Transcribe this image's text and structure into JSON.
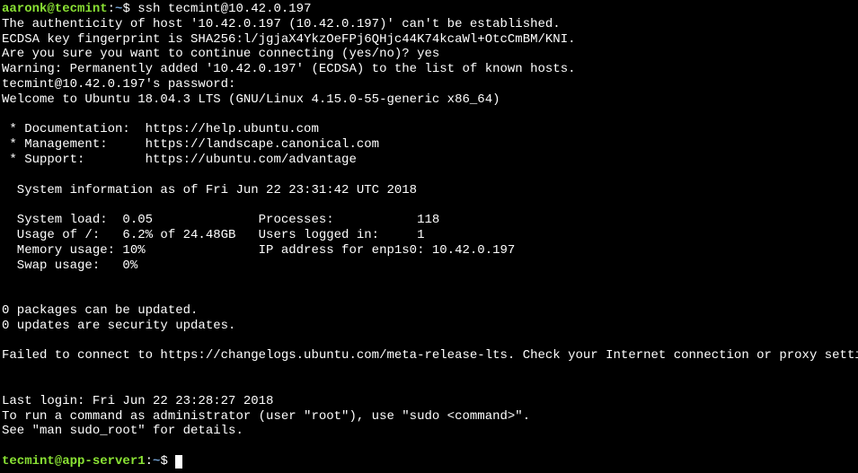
{
  "prompt1": {
    "user_host": "aaronk@tecmint",
    "colon": ":",
    "tilde": "~",
    "dollar": "$ ",
    "command": "ssh tecmint@10.42.0.197"
  },
  "lines": {
    "l1": "The authenticity of host '10.42.0.197 (10.42.0.197)' can't be established.",
    "l2": "ECDSA key fingerprint is SHA256:l/jgjaX4YkzOeFPj6QHjc44K74kcaWl+OtcCmBM/KNI.",
    "l3": "Are you sure you want to continue connecting (yes/no)? yes",
    "l4": "Warning: Permanently added '10.42.0.197' (ECDSA) to the list of known hosts.",
    "l5": "tecmint@10.42.0.197's password:",
    "l6": "Welcome to Ubuntu 18.04.3 LTS (GNU/Linux 4.15.0-55-generic x86_64)",
    "l7": "",
    "l8": " * Documentation:  https://help.ubuntu.com",
    "l9": " * Management:     https://landscape.canonical.com",
    "l10": " * Support:        https://ubuntu.com/advantage",
    "l11": "",
    "l12": "  System information as of Fri Jun 22 23:31:42 UTC 2018",
    "l13": "",
    "l14": "  System load:  0.05              Processes:           118",
    "l15": "  Usage of /:   6.2% of 24.48GB   Users logged in:     1",
    "l16": "  Memory usage: 10%               IP address for enp1s0: 10.42.0.197",
    "l17": "  Swap usage:   0%",
    "l18": "",
    "l19": "",
    "l20": "0 packages can be updated.",
    "l21": "0 updates are security updates.",
    "l22": "",
    "l23": "Failed to connect to https://changelogs.ubuntu.com/meta-release-lts. Check your Internet connection or proxy settings",
    "l24": "",
    "l25": "",
    "l26": "Last login: Fri Jun 22 23:28:27 2018",
    "l27": "To run a command as administrator (user \"root\"), use \"sudo <command>\".",
    "l28": "See \"man sudo_root\" for details.",
    "l29": ""
  },
  "prompt2": {
    "user_host": "tecmint@app-server1",
    "colon": ":",
    "tilde": "~",
    "dollar": "$ "
  }
}
